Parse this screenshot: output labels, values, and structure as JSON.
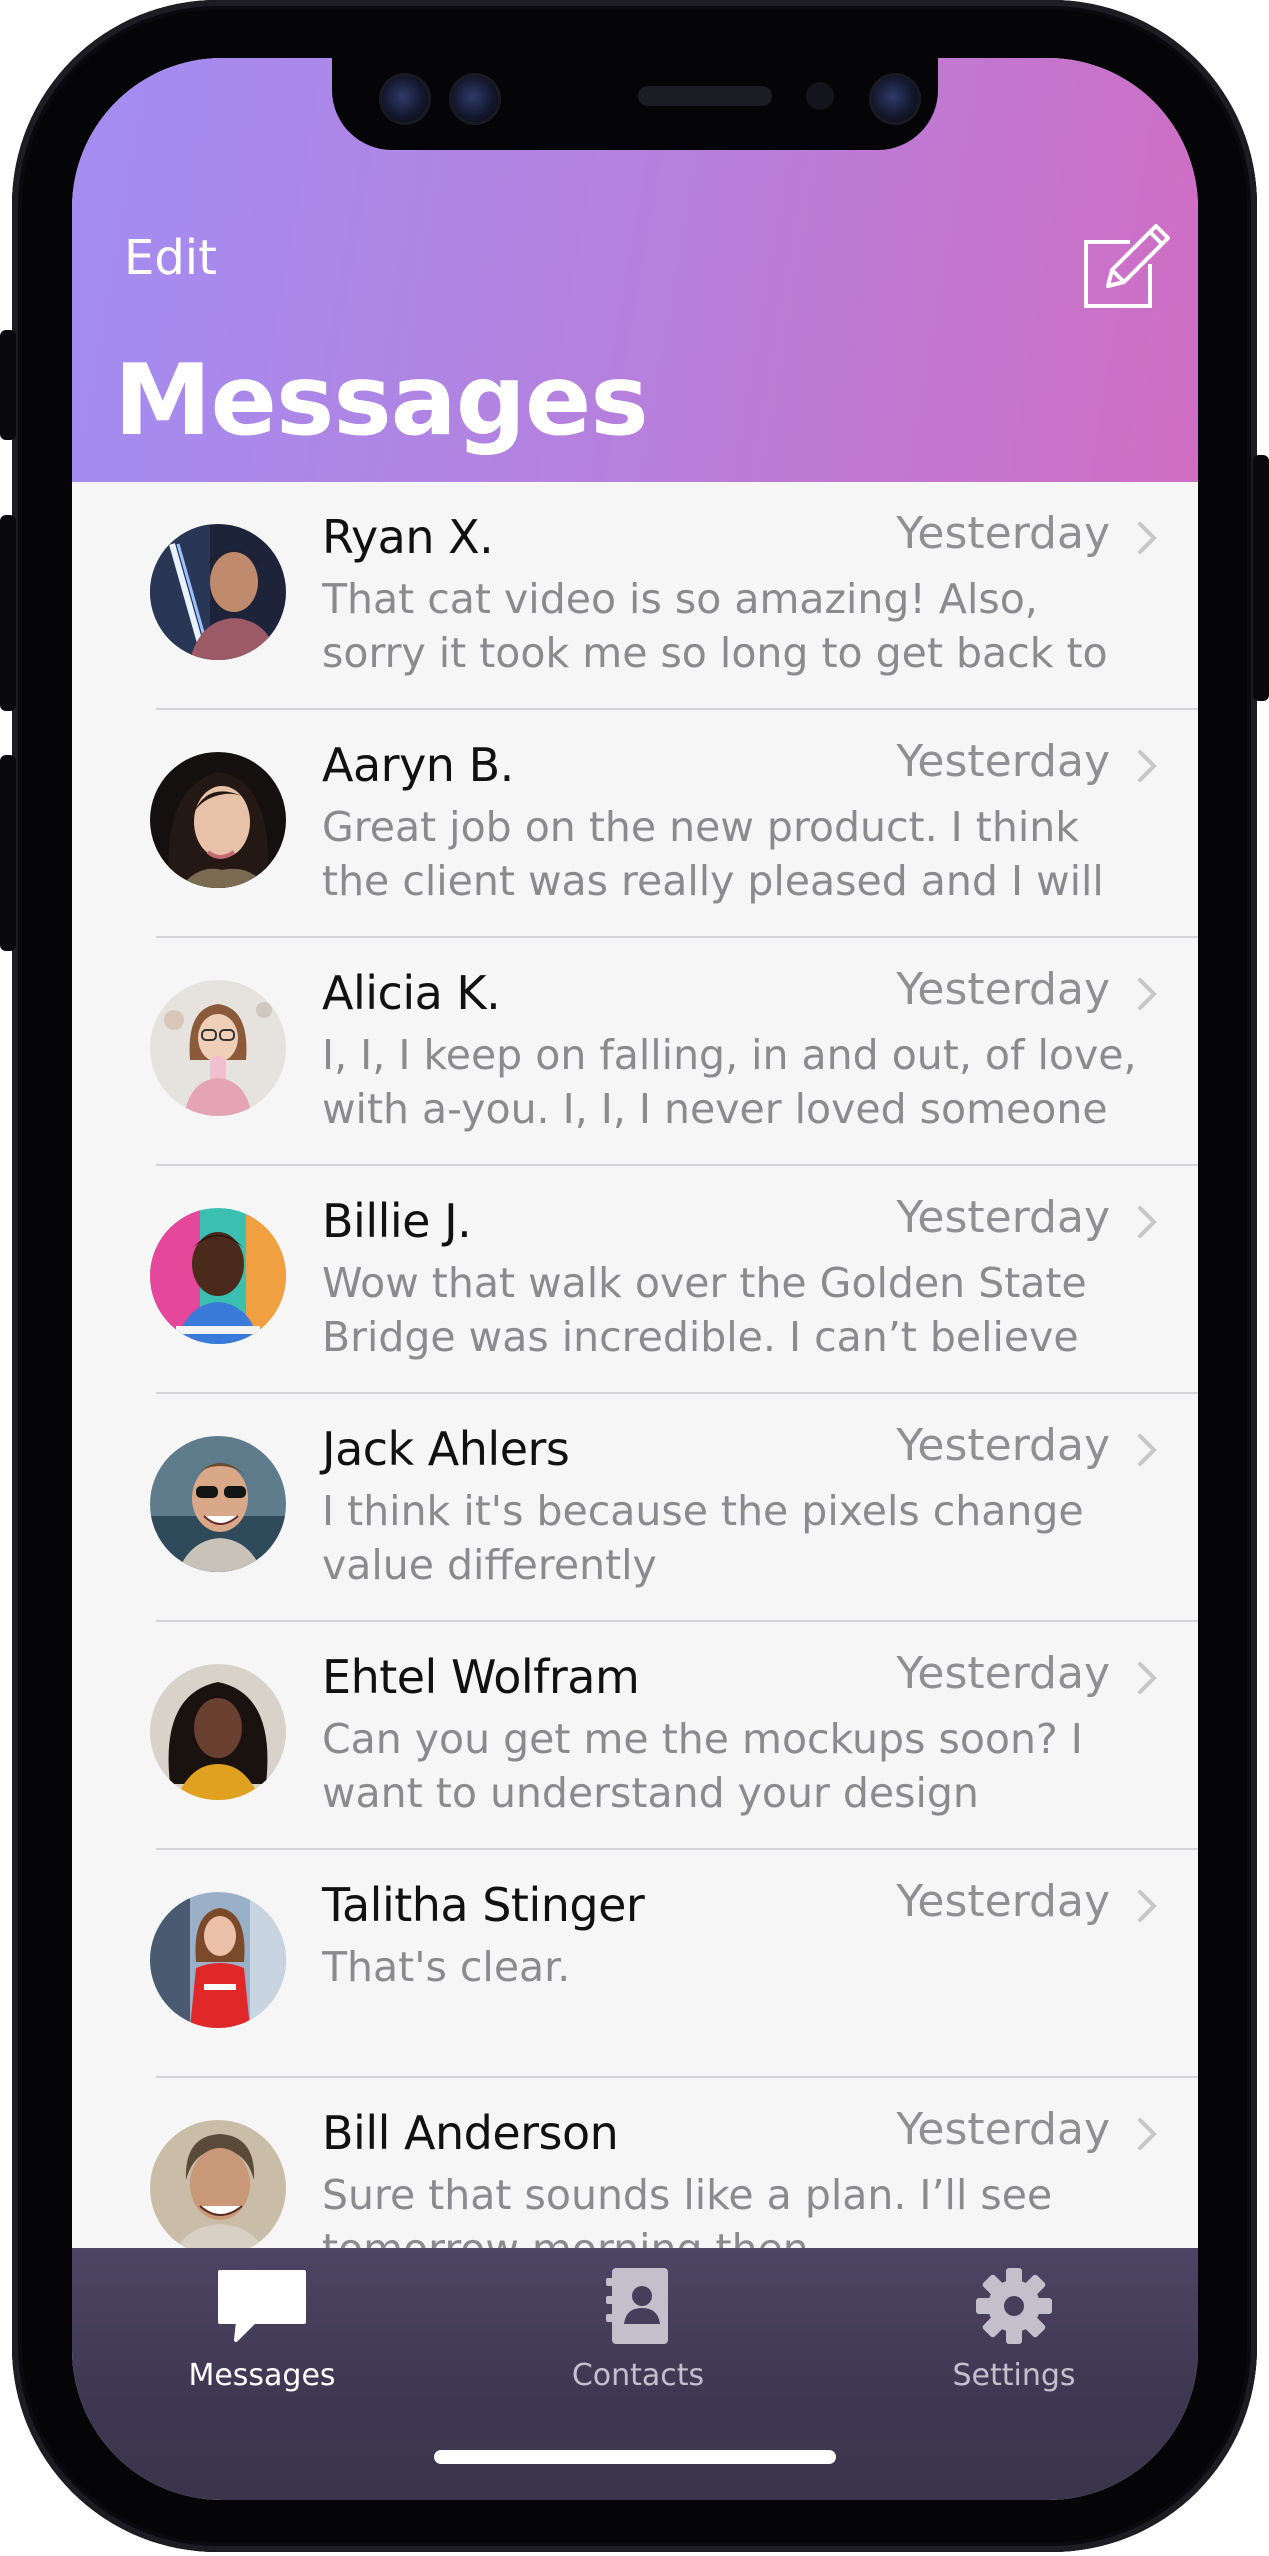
{
  "header": {
    "edit_label": "Edit",
    "title": "Messages",
    "compose_icon": "compose-icon"
  },
  "conversations": [
    {
      "name": "Ryan X.",
      "time": "Yesterday",
      "preview": "That cat video is so amazing! Also, sorry it took me so long to get back to you I ..."
    },
    {
      "name": "Aaryn B.",
      "time": "Yesterday",
      "preview": "Great job on the new product. I think the client was really pleased and I will defi..."
    },
    {
      "name": "Alicia K.",
      "time": "Yesterday",
      "preview": "I, I, I keep on falling, in and out, of love, with a-you. I, I, I never loved someone t..."
    },
    {
      "name": "Billie J.",
      "time": "Yesterday",
      "preview": "Wow that walk over the Golden State Bridge was incredible. I can’t believe I..."
    },
    {
      "name": "Jack Ahlers",
      "time": "Yesterday",
      "preview": "I think it's because the pixels change value differently"
    },
    {
      "name": "Ehtel Wolfram",
      "time": "Yesterday",
      "preview": "Can you get me the mockups soon? I want to understand your design process."
    },
    {
      "name": "Talitha Stinger",
      "time": "Yesterday",
      "preview": "That's clear."
    },
    {
      "name": "Bill Anderson",
      "time": "Yesterday",
      "preview": "Sure that sounds like a plan. I’ll see tomorrow morning then."
    }
  ],
  "tabbar": {
    "tabs": [
      {
        "label": "Messages",
        "icon": "chat-bubble-icon",
        "active": true
      },
      {
        "label": "Contacts",
        "icon": "contacts-book-icon",
        "active": false
      },
      {
        "label": "Settings",
        "icon": "gear-icon",
        "active": false
      }
    ]
  },
  "colors": {
    "header_gradient_start": "#a38df2",
    "header_gradient_end": "#d06dc3",
    "tabbar_background": "#463f5b",
    "active_tab": "#ffffff",
    "inactive_tab": "#c3c0cc"
  }
}
